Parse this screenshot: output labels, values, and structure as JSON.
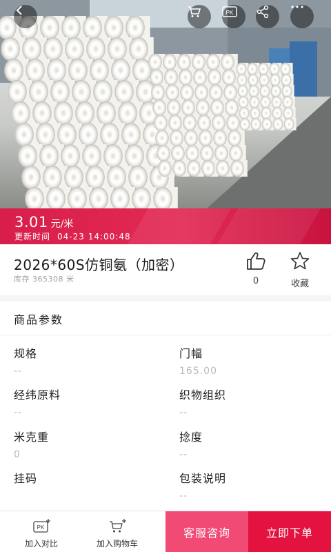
{
  "header": {
    "icons": [
      "back-icon",
      "cart-icon",
      "pk-icon",
      "share-icon",
      "more-icon"
    ],
    "pk_badge": "PK"
  },
  "price": {
    "value": "3.01",
    "unit": "元/米",
    "updated_label": "更新时间",
    "updated_time": "04-23 14:00:48",
    "bg_color": "#e22a55"
  },
  "product": {
    "title": "2026*60S仿铜氨（加密）",
    "stock_label": "库存",
    "stock_value": "365308",
    "stock_unit": "米",
    "like_count": "0",
    "favorite_label": "收藏"
  },
  "params": {
    "heading": "商品参数",
    "items": [
      {
        "label": "规格",
        "value": "--"
      },
      {
        "label": "门幅",
        "value": "165.00"
      },
      {
        "label": "经纬原料",
        "value": "--"
      },
      {
        "label": "织物组织",
        "value": "--"
      },
      {
        "label": "米克重",
        "value": "0"
      },
      {
        "label": "捻度",
        "value": "--"
      },
      {
        "label": "挂码",
        "value": ""
      },
      {
        "label": "包装说明",
        "value": "--"
      }
    ]
  },
  "bottom_bar": {
    "compare_label": "加入对比",
    "cart_label": "加入购物车",
    "consult_label": "客服咨询",
    "order_label": "立即下单",
    "consult_color": "#f04a75",
    "order_color": "#e4123f"
  }
}
